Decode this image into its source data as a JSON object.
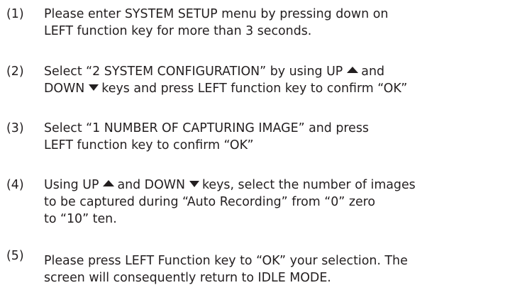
{
  "steps": [
    {
      "number": "(1)",
      "lines": [
        "Please enter SYSTEM SETUP menu by pressing down on",
        "LEFT function key for more than 3 seconds."
      ]
    },
    {
      "number": "(2)",
      "line1_a": "Select “2 SYSTEM CONFIGURATION” by using UP",
      "line1_b": "and",
      "line2_a": "DOWN",
      "line2_b": "keys and press LEFT function key to confirm “OK”"
    },
    {
      "number": "(3)",
      "lines": [
        "Select “1 NUMBER OF CAPTURING IMAGE” and press",
        "LEFT function key to confirm “OK”"
      ]
    },
    {
      "number": "(4)",
      "line1_a": "Using UP",
      "line1_b": "and DOWN",
      "line1_c": "keys, select the number of images",
      "line2": "to be captured during “Auto Recording” from “0” zero",
      "line3": "to “10” ten."
    },
    {
      "number": "(5)",
      "lines": [
        "Please press LEFT Function key to “OK” your selection. The",
        "screen will consequently return to IDLE MODE."
      ]
    }
  ],
  "icons": {
    "up": "up-arrow-icon",
    "down": "down-arrow-icon"
  }
}
